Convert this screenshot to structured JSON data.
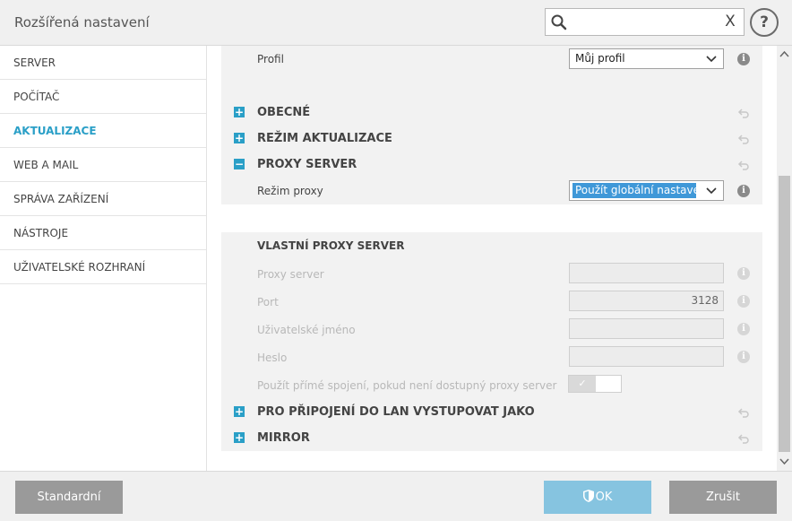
{
  "header": {
    "title": "Rozšířená nastavení",
    "search_placeholder": "",
    "clear_glyph": "X",
    "help_glyph": "?"
  },
  "sidebar": {
    "items": [
      {
        "label": "SERVER"
      },
      {
        "label": "POČÍTAČ"
      },
      {
        "label": "AKTUALIZACE"
      },
      {
        "label": "WEB A MAIL"
      },
      {
        "label": "SPRÁVA ZAŘÍZENÍ"
      },
      {
        "label": "NÁSTROJE"
      },
      {
        "label": "UŽIVATELSKÉ ROZHRANÍ"
      }
    ],
    "active_index": 2
  },
  "main": {
    "profile": {
      "label": "Profil",
      "value": "Můj profil"
    },
    "sections": {
      "general": {
        "label": "OBECNÉ",
        "toggle": "+"
      },
      "update_mode": {
        "label": "REŽIM AKTUALIZACE",
        "toggle": "+"
      },
      "proxy_server": {
        "label": "PROXY SERVER",
        "toggle": "−"
      },
      "lan": {
        "label": "PRO PŘIPOJENÍ DO LAN VYSTUPOVAT JAKO",
        "toggle": "+"
      },
      "mirror": {
        "label": "MIRROR",
        "toggle": "+"
      }
    },
    "proxy_mode": {
      "label": "Režim proxy",
      "value": "Použít globální nastave..."
    },
    "custom_proxy": {
      "heading": "VLASTNÍ PROXY SERVER",
      "server_label": "Proxy server",
      "server_value": "",
      "port_label": "Port",
      "port_value": "3128",
      "username_label": "Uživatelské jméno",
      "username_value": "",
      "password_label": "Heslo",
      "password_value": "",
      "direct_label": "Použít přímé spojení, pokud není dostupný proxy server",
      "direct_glyph": "✓"
    },
    "info_glyph": "i"
  },
  "footer": {
    "standard": "Standardní",
    "ok": "OK",
    "cancel": "Zrušit"
  },
  "colors": {
    "accent": "#2a9fc7",
    "ok_button": "#86c4e0",
    "gray_button": "#9a9a9a",
    "selection": "#3f98d8"
  }
}
